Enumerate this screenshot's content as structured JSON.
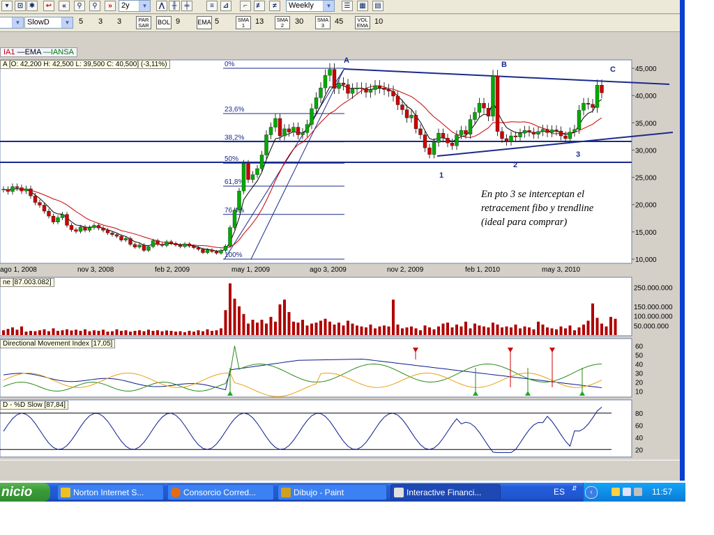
{
  "toolbar1": {
    "period_value": "2y",
    "interval_value": "Weekly",
    "icons": [
      "undo-icon",
      "rewind-icon",
      "zoom-in-icon",
      "zoom-out-icon",
      "forward-icon",
      "line-icon",
      "bar-icon",
      "candle-icon",
      "menu-icon",
      "grid-icon",
      "table-icon"
    ]
  },
  "toolbar2": {
    "study_select": "SlowD",
    "study_params": [
      "5",
      "3",
      "3"
    ],
    "indicators": [
      {
        "label": "PAR\nSAR",
        "value": ""
      },
      {
        "label": "BOL",
        "value": "9"
      },
      {
        "label": "EMA",
        "value": "5"
      },
      {
        "label": "SMA\n1",
        "value": "13"
      },
      {
        "label": "SMA\n2",
        "value": "30"
      },
      {
        "label": "SMA\n3",
        "value": "45"
      },
      {
        "label": "VOL\nEMA",
        "value": "10"
      }
    ]
  },
  "legend": {
    "sma": "IA1",
    "ema": "EMA",
    "ticker": "IANSA",
    "colors": {
      "sma": "#cc0000",
      "ema": "#000000",
      "ticker": "#007700"
    }
  },
  "price_label": "A [O: 42,200  H: 42,500  L: 39,500  C: 40,500] (-3,11%)",
  "volume_label": "ne [87.003.082]",
  "dmi_label": "Directional Movement Index [17,05]",
  "stoch_label": "D - %D Slow [87,84]",
  "annotation": {
    "lines": [
      "En pto 3 se interceptan el",
      "retracement fibo y trendline",
      "(ideal para comprar)"
    ]
  },
  "chart_data": [
    {
      "type": "candlestick",
      "pane": "price",
      "x_tick_labels": [
        "ago 1, 2008",
        "nov 3, 2008",
        "feb 2, 2009",
        "may 1, 2009",
        "ago 3, 2009",
        "nov 2, 2009",
        "feb 1, 2010",
        "may 3, 2010"
      ],
      "y_tick_labels": [
        "45,000",
        "40,000",
        "35,000",
        "30,000",
        "25,000",
        "20,000",
        "15,000",
        "10,000"
      ],
      "ylim": [
        10000,
        45000
      ],
      "up_color": "#00aa00",
      "down_color": "#cc0000",
      "closes": [
        22800,
        22400,
        23300,
        23100,
        22500,
        22900,
        21600,
        20400,
        19900,
        18800,
        17900,
        16800,
        17600,
        18200,
        16200,
        15400,
        15100,
        15900,
        15300,
        15800,
        16200,
        15700,
        15300,
        14800,
        14500,
        14200,
        13500,
        13800,
        12700,
        12200,
        12600,
        11600,
        12300,
        13400,
        12700,
        12500,
        13200,
        12900,
        12600,
        12300,
        12800,
        12400,
        12100,
        11800,
        11200,
        11700,
        11400,
        11100,
        11600,
        12400,
        15800,
        19000,
        22500,
        27500,
        24600,
        25500,
        26600,
        29100,
        32800,
        34200,
        35800,
        32600,
        33900,
        33300,
        34200,
        32800,
        33200,
        34700,
        37600,
        39600,
        41400,
        43700,
        44800,
        41300,
        42300,
        42000,
        40400,
        41200,
        41400,
        41300,
        40600,
        41100,
        41800,
        41400,
        41100,
        40800,
        39900,
        38300,
        37400,
        35900,
        36400,
        33900,
        32800,
        30400,
        29200,
        31400,
        33100,
        32200,
        31300,
        30800,
        32800,
        33600,
        32900,
        35600,
        36900,
        38600,
        37700,
        36200,
        43600,
        33400,
        32100,
        31600,
        32600,
        32400,
        33100,
        33600,
        33300,
        32900,
        33400,
        33800,
        33200,
        33700,
        33500,
        32600,
        32100,
        33300,
        33800,
        37300,
        38600,
        38400,
        37800,
        41900,
        40500
      ],
      "ohlc_dates": "weekly, approx Jun 2008 – Jun 2010",
      "overlays": [
        {
          "name": "EMA",
          "color": "#000000"
        },
        {
          "name": "SMA",
          "color": "#cc0000"
        }
      ],
      "fibonacci_levels": [
        {
          "label": "0%",
          "value": 45000
        },
        {
          "label": "23,6%",
          "value": 36700
        },
        {
          "label": "38,2%",
          "value": 31500
        },
        {
          "label": "50%",
          "value": 27600
        },
        {
          "label": "61,8%",
          "value": 23400
        },
        {
          "label": "76,4%",
          "value": 18200
        },
        {
          "label": "100%",
          "value": 10000
        }
      ],
      "point_labels": [
        "A",
        "B",
        "C",
        "1",
        "2",
        "3"
      ]
    },
    {
      "type": "bar",
      "pane": "volume",
      "y_tick_labels": [
        "250.000.000",
        "150.000.000",
        "100.000.000",
        "50.000.000"
      ],
      "ylim": [
        0,
        280000000
      ],
      "color": "#b00000",
      "values_millions": [
        25,
        32,
        40,
        28,
        45,
        18,
        22,
        20,
        25,
        30,
        20,
        35,
        22,
        25,
        30,
        24,
        28,
        22,
        30,
        20,
        25,
        22,
        28,
        18,
        20,
        30,
        22,
        25,
        18,
        22,
        25,
        20,
        28,
        22,
        25,
        20,
        24,
        22,
        18,
        20,
        15,
        22,
        18,
        25,
        20,
        30,
        22,
        25,
        35,
        130,
        270,
        190,
        150,
        110,
        60,
        80,
        65,
        80,
        60,
        95,
        70,
        160,
        185,
        120,
        70,
        65,
        80,
        50,
        60,
        65,
        75,
        85,
        70,
        55,
        65,
        50,
        75,
        60,
        50,
        45,
        40,
        55,
        35,
        45,
        50,
        45,
        185,
        55,
        35,
        40,
        45,
        35,
        25,
        50,
        40,
        30,
        45,
        60,
        65,
        40,
        55,
        45,
        70,
        35,
        60,
        50,
        45,
        40,
        65,
        55,
        40,
        45,
        40,
        55,
        35,
        45,
        40,
        30,
        70,
        55,
        40,
        35,
        30,
        45,
        35,
        50,
        25,
        40,
        55,
        75,
        165,
        90,
        60,
        45,
        95,
        85
      ]
    },
    {
      "type": "line",
      "pane": "dmi",
      "y_tick_labels": [
        "60",
        "50",
        "40",
        "30",
        "20",
        "10"
      ],
      "ylim": [
        5,
        65
      ],
      "series_colors": [
        "#0a1a8a",
        "#2a8a1a",
        "#e8a010",
        "#cc0000"
      ]
    },
    {
      "type": "line",
      "pane": "stochastic",
      "y_tick_labels": [
        "80",
        "60",
        "40",
        "20"
      ],
      "ylim": [
        10,
        95
      ],
      "color": "#0a1a8a",
      "reference_lines": [
        80,
        20
      ]
    }
  ],
  "taskbar": {
    "start_label": "nicio",
    "tasks": [
      {
        "label": "Norton Internet S...",
        "icon_color": "#f0c020"
      },
      {
        "label": "Consorcio Corred...",
        "icon_color": "#e86a10"
      },
      {
        "label": "Dibujo - Paint",
        "icon_color": "#d0a020"
      },
      {
        "label": "Interactive Financi...",
        "icon_color": "#e0e0e0"
      }
    ],
    "language": "ES",
    "clock": "11:57"
  }
}
